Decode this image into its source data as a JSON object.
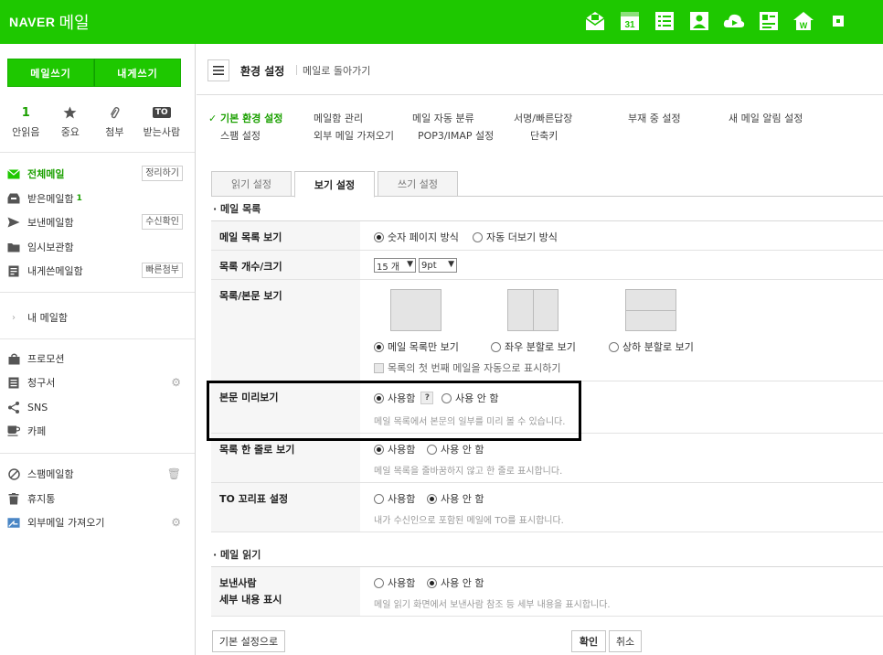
{
  "header": {
    "brand_naver": "NAVER",
    "brand_mail": "메일",
    "icons": [
      "mail-icon",
      "calendar-icon",
      "list-icon",
      "contacts-icon",
      "cloud-icon",
      "memo-icon",
      "home-icon",
      "more-icon"
    ],
    "calendar_day": "31"
  },
  "sidebar": {
    "write_label": "메일쓰기",
    "self_write_label": "내게쓰기",
    "quick": [
      {
        "top": "1",
        "label": "안읽음"
      },
      {
        "top": "★",
        "label": "중요"
      },
      {
        "top": "📎",
        "label": "첨부"
      },
      {
        "top": "TO",
        "label": "받는사람"
      }
    ],
    "folders": [
      {
        "label": "전체메일",
        "pill": "정리하기"
      },
      {
        "label": "받은메일함",
        "count": "1"
      },
      {
        "label": "보낸메일함",
        "pill": "수신확인"
      },
      {
        "label": "임시보관함"
      },
      {
        "label": "내게쓴메일함",
        "pill": "빠른첨부"
      }
    ],
    "my_mailbox": "내 메일함",
    "extras": [
      {
        "label": "프로모션"
      },
      {
        "label": "청구서"
      },
      {
        "label": "SNS"
      },
      {
        "label": "카페"
      }
    ],
    "bottom": [
      {
        "label": "스팸메일함"
      },
      {
        "label": "휴지통"
      },
      {
        "label": "외부메일 가져오기"
      }
    ]
  },
  "main": {
    "title": "환경 설정",
    "back_link": "메일로 돌아가기",
    "settings_nav": [
      "기본 환경 설정",
      "메일함 관리",
      "메일 자동 분류",
      "서명/빠른답장",
      "부재 중 설정",
      "새 메일 알림 설정",
      "스팸 설정",
      "외부 메일 가져오기",
      "POP3/IMAP 설정",
      "단축키"
    ],
    "tabs": [
      "읽기 설정",
      "보기 설정",
      "쓰기 설정"
    ],
    "section_list": "메일 목록",
    "list_view": {
      "label": "메일 목록 보기",
      "options": [
        "숫자 페이지 방식",
        "자동 더보기 방식"
      ]
    },
    "list_count": {
      "label": "목록 개수/크기",
      "count_value": "15 개",
      "size_value": "9pt"
    },
    "list_body": {
      "label": "목록/본문 보기",
      "options": [
        "메일 목록만 보기",
        "좌우 분할로 보기",
        "상하 분할로 보기"
      ],
      "auto_show": "목록의 첫 번째 메일을 자동으로 표시하기"
    },
    "preview": {
      "label": "본문 미리보기",
      "on": "사용함",
      "off": "사용 안 함",
      "help": "?",
      "desc": "메일 목록에서 본문의 일부를 미리 볼 수 있습니다."
    },
    "one_line": {
      "label": "목록 한 줄로 보기",
      "on": "사용함",
      "off": "사용 안 함",
      "desc": "메일 목록을 줄바꿈하지 않고 한 줄로 표시합니다."
    },
    "to_mark": {
      "label": "TO 꼬리표 설정",
      "on": "사용함",
      "off": "사용 안 함",
      "desc": "내가 수신인으로 포함된 메일에 TO를 표시합니다."
    },
    "section_read": "메일 읽기",
    "sender_detail": {
      "label_line1": "보낸사람",
      "label_line2": "세부 내용 표시",
      "on": "사용함",
      "off": "사용 안 함",
      "desc": "메일 읽기 화면에서 보낸사람 참조 등 세부 내용을 표시합니다."
    },
    "buttons": {
      "reset": "기본 설정으로",
      "confirm": "확인",
      "cancel": "취소"
    }
  }
}
